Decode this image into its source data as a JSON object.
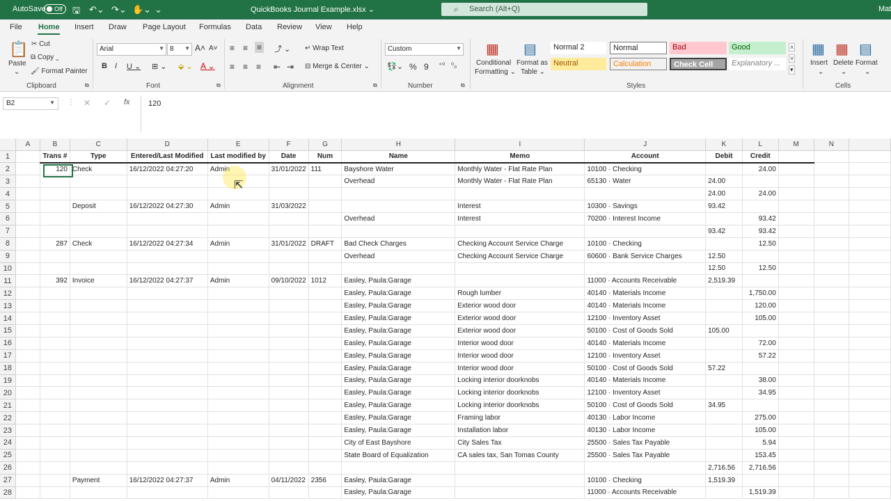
{
  "titlebar": {
    "autosave_label": "AutoSave",
    "autosave_state": "Off",
    "filename": "QuickBooks Journal Example.xlsx ⌄",
    "search_placeholder": "Search (Alt+Q)",
    "account": "Mat"
  },
  "tabs": [
    "File",
    "Home",
    "Insert",
    "Draw",
    "Page Layout",
    "Formulas",
    "Data",
    "Review",
    "View",
    "Help"
  ],
  "ribbon": {
    "clipboard": {
      "paste": "Paste",
      "cut": "Cut",
      "copy": "Copy",
      "format_painter": "Format Painter",
      "label": "Clipboard"
    },
    "font": {
      "name": "Arial",
      "size": "8",
      "label": "Font"
    },
    "alignment": {
      "wrap": "Wrap Text",
      "merge": "Merge & Center",
      "label": "Alignment"
    },
    "number": {
      "format": "Custom",
      "label": "Number"
    },
    "styles": {
      "cond_line1": "Conditional",
      "cond_line2": "Formatting",
      "fmt_line1": "Format as",
      "fmt_line2": "Table",
      "normal2": "Normal 2",
      "normal": "Normal",
      "bad": "Bad",
      "good": "Good",
      "neutral": "Neutral",
      "calculation": "Calculation",
      "check": "Check Cell",
      "explanatory": "Explanatory ...",
      "label": "Styles"
    },
    "cells": {
      "insert": "Insert",
      "delete": "Delete",
      "format": "Format",
      "label": "Cells"
    }
  },
  "formula_bar": {
    "name_box": "B2",
    "content": "120"
  },
  "columns": [
    "A",
    "B",
    "C",
    "D",
    "E",
    "F",
    "G",
    "H",
    "I",
    "J",
    "K",
    "L",
    "M",
    "N"
  ],
  "rows": [
    [
      "1",
      "",
      "Trans #",
      "Type",
      "Entered/Last Modified",
      "Last modified by",
      "Date",
      "Num",
      "Name",
      "Memo",
      "Account",
      "Debit",
      "Credit",
      "",
      ""
    ],
    [
      "2",
      "",
      "120",
      "Check",
      "16/12/2022 04:27:20",
      "Admin",
      "31/01/2022",
      "111",
      "Bayshore Water",
      "Monthly Water - Flat Rate Plan",
      "10100 · Checking",
      "",
      "24.00",
      "",
      ""
    ],
    [
      "3",
      "",
      "",
      "",
      "",
      "",
      "",
      "",
      "Overhead",
      "Monthly Water - Flat Rate Plan",
      "65130 · Water",
      "24.00",
      "",
      "",
      ""
    ],
    [
      "4",
      "",
      "",
      "",
      "",
      "",
      "",
      "",
      "",
      "",
      "",
      "24.00",
      "24.00",
      "",
      ""
    ],
    [
      "5",
      "",
      "",
      "Deposit",
      "16/12/2022 04:27:30",
      "Admin",
      "31/03/2022",
      "",
      "",
      "Interest",
      "10300 · Savings",
      "93.42",
      "",
      "",
      ""
    ],
    [
      "6",
      "",
      "",
      "",
      "",
      "",
      "",
      "",
      "Overhead",
      "Interest",
      "70200 · Interest Income",
      "",
      "93.42",
      "",
      ""
    ],
    [
      "7",
      "",
      "",
      "",
      "",
      "",
      "",
      "",
      "",
      "",
      "",
      "93.42",
      "93.42",
      "",
      ""
    ],
    [
      "8",
      "",
      "287",
      "Check",
      "16/12/2022 04:27:34",
      "Admin",
      "31/01/2022",
      "DRAFT",
      "Bad Check Charges",
      "Checking Account Service Charge",
      "10100 · Checking",
      "",
      "12.50",
      "",
      ""
    ],
    [
      "9",
      "",
      "",
      "",
      "",
      "",
      "",
      "",
      "Overhead",
      "Checking Account Service Charge",
      "60600 · Bank Service Charges",
      "12.50",
      "",
      "",
      ""
    ],
    [
      "10",
      "",
      "",
      "",
      "",
      "",
      "",
      "",
      "",
      "",
      "",
      "12.50",
      "12.50",
      "",
      ""
    ],
    [
      "11",
      "",
      "392",
      "Invoice",
      "16/12/2022 04:27:37",
      "Admin",
      "09/10/2022",
      "1012",
      "Easley, Paula:Garage",
      "",
      "11000 · Accounts Receivable",
      "2,519.39",
      "",
      "",
      ""
    ],
    [
      "12",
      "",
      "",
      "",
      "",
      "",
      "",
      "",
      "Easley, Paula:Garage",
      "Rough lumber",
      "40140 · Materials Income",
      "",
      "1,750.00",
      "",
      ""
    ],
    [
      "13",
      "",
      "",
      "",
      "",
      "",
      "",
      "",
      "Easley, Paula:Garage",
      "Exterior wood door",
      "40140 · Materials Income",
      "",
      "120.00",
      "",
      ""
    ],
    [
      "14",
      "",
      "",
      "",
      "",
      "",
      "",
      "",
      "Easley, Paula:Garage",
      "Exterior wood door",
      "12100 · Inventory Asset",
      "",
      "105.00",
      "",
      ""
    ],
    [
      "15",
      "",
      "",
      "",
      "",
      "",
      "",
      "",
      "Easley, Paula:Garage",
      "Exterior wood door",
      "50100 · Cost of Goods Sold",
      "105.00",
      "",
      "",
      ""
    ],
    [
      "16",
      "",
      "",
      "",
      "",
      "",
      "",
      "",
      "Easley, Paula:Garage",
      "Interior wood door",
      "40140 · Materials Income",
      "",
      "72.00",
      "",
      ""
    ],
    [
      "17",
      "",
      "",
      "",
      "",
      "",
      "",
      "",
      "Easley, Paula:Garage",
      "Interior wood door",
      "12100 · Inventory Asset",
      "",
      "57.22",
      "",
      ""
    ],
    [
      "18",
      "",
      "",
      "",
      "",
      "",
      "",
      "",
      "Easley, Paula:Garage",
      "Interior wood door",
      "50100 · Cost of Goods Sold",
      "57.22",
      "",
      "",
      ""
    ],
    [
      "19",
      "",
      "",
      "",
      "",
      "",
      "",
      "",
      "Easley, Paula:Garage",
      "Locking interior doorknobs",
      "40140 · Materials Income",
      "",
      "38.00",
      "",
      ""
    ],
    [
      "20",
      "",
      "",
      "",
      "",
      "",
      "",
      "",
      "Easley, Paula:Garage",
      "Locking interior doorknobs",
      "12100 · Inventory Asset",
      "",
      "34.95",
      "",
      ""
    ],
    [
      "21",
      "",
      "",
      "",
      "",
      "",
      "",
      "",
      "Easley, Paula:Garage",
      "Locking interior doorknobs",
      "50100 · Cost of Goods Sold",
      "34.95",
      "",
      "",
      ""
    ],
    [
      "22",
      "",
      "",
      "",
      "",
      "",
      "",
      "",
      "Easley, Paula:Garage",
      "Framing labor",
      "40130 · Labor Income",
      "",
      "275.00",
      "",
      ""
    ],
    [
      "23",
      "",
      "",
      "",
      "",
      "",
      "",
      "",
      "Easley, Paula:Garage",
      "Installation labor",
      "40130 · Labor Income",
      "",
      "105.00",
      "",
      ""
    ],
    [
      "24",
      "",
      "",
      "",
      "",
      "",
      "",
      "",
      "City of East Bayshore",
      "City Sales Tax",
      "25500 · Sales Tax Payable",
      "",
      "5.94",
      "",
      ""
    ],
    [
      "25",
      "",
      "",
      "",
      "",
      "",
      "",
      "",
      "State Board of Equalization",
      "CA sales tax, San Tomas County",
      "25500 · Sales Tax Payable",
      "",
      "153.45",
      "",
      ""
    ],
    [
      "26",
      "",
      "",
      "",
      "",
      "",
      "",
      "",
      "",
      "",
      "",
      "2,716.56",
      "2,716.56",
      "",
      ""
    ],
    [
      "27",
      "",
      "",
      "Payment",
      "16/12/2022 04:27:37",
      "Admin",
      "04/11/2022",
      "2356",
      "Easley, Paula:Garage",
      "",
      "10100 · Checking",
      "1,519.39",
      "",
      "",
      ""
    ],
    [
      "28",
      "",
      "",
      "",
      "",
      "",
      "",
      "",
      "Easley, Paula:Garage",
      "",
      "11000 · Accounts Receivable",
      "",
      "1,519.39",
      "",
      ""
    ]
  ]
}
